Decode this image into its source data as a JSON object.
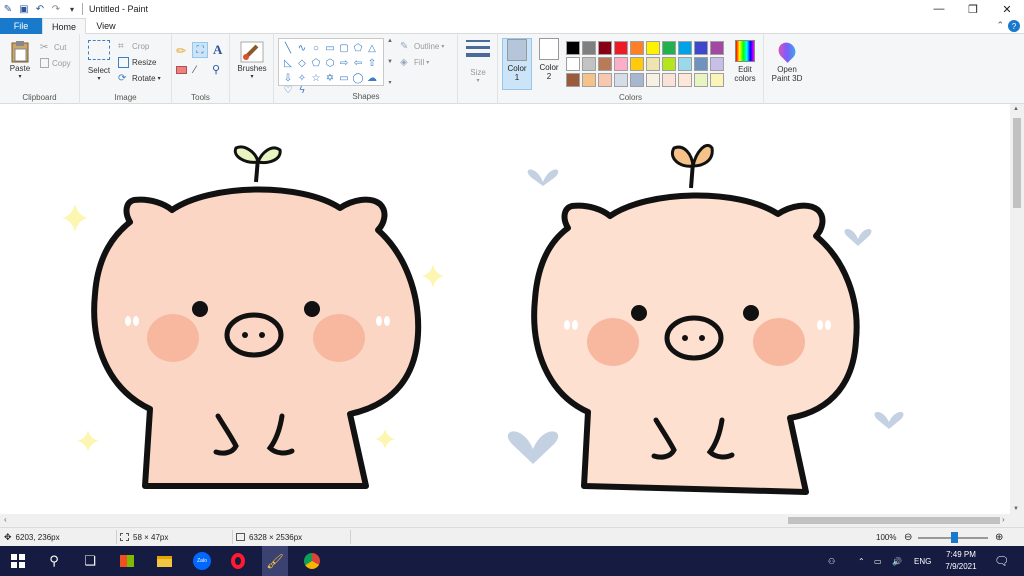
{
  "window": {
    "title": "Untitled - Paint",
    "controls": {
      "minimize": "—",
      "maximize": "❐",
      "close": "✕"
    }
  },
  "menu_tabs": [
    "File",
    "Home",
    "View"
  ],
  "ribbon": {
    "clipboard": {
      "paste": "Paste",
      "cut": "Cut",
      "copy": "Copy",
      "label": "Clipboard"
    },
    "image": {
      "select": "Select",
      "crop": "Crop",
      "resize": "Resize",
      "rotate": "Rotate",
      "label": "Image"
    },
    "tools": {
      "label": "Tools"
    },
    "brushes": {
      "label": "Brushes"
    },
    "shapes": {
      "outline": "Outline",
      "fill": "Fill",
      "label": "Shapes"
    },
    "size": {
      "label": "Size"
    },
    "colors": {
      "color1": "Color",
      "color1_num": "1",
      "color2": "Color",
      "color2_num": "2",
      "edit": "Edit",
      "edit2": "colors",
      "label": "Colors",
      "color1_value": "#000000",
      "color2_value": "#ffffff",
      "palette": [
        "#000000",
        "#7f7f7f",
        "#880015",
        "#ed1c24",
        "#ff7f27",
        "#fff200",
        "#22b14c",
        "#00a2e8",
        "#3f48cc",
        "#a349a4",
        "#ffffff",
        "#c3c3c3",
        "#b97a57",
        "#ffaec9",
        "#ffc90e",
        "#efe4b0",
        "#b5e61d",
        "#99d9ea",
        "#7092be",
        "#c8bfe7",
        "#9c5a3c",
        "#f5c38a",
        "#f8c7b0",
        "#d4dce8",
        "#a6b7d0",
        "#f7f1e3",
        "#fbe2d6",
        "#fde7d9",
        "#e8f5c0",
        "#fcf5b8"
      ]
    },
    "paint3d": {
      "line1": "Open",
      "line2": "Paint 3D"
    }
  },
  "status": {
    "cursor": "6203, 236px",
    "selection": "58 × 47px",
    "canvas_size": "6328 × 2536px",
    "zoom": "100%"
  },
  "taskbar": {
    "time": "7:49 PM",
    "date": "7/9/2021",
    "lang": "ENG",
    "apps": [
      "Zalo"
    ]
  },
  "canvas_colors": {
    "pig_fill": "#fbd6c4",
    "outline": "#111111",
    "cheek": "#f7b89f",
    "star": "#fdf6b0",
    "heart": "#c4d1e3",
    "sprout_green": "#e8f5c0",
    "sprout_orange": "#f5c38a"
  }
}
